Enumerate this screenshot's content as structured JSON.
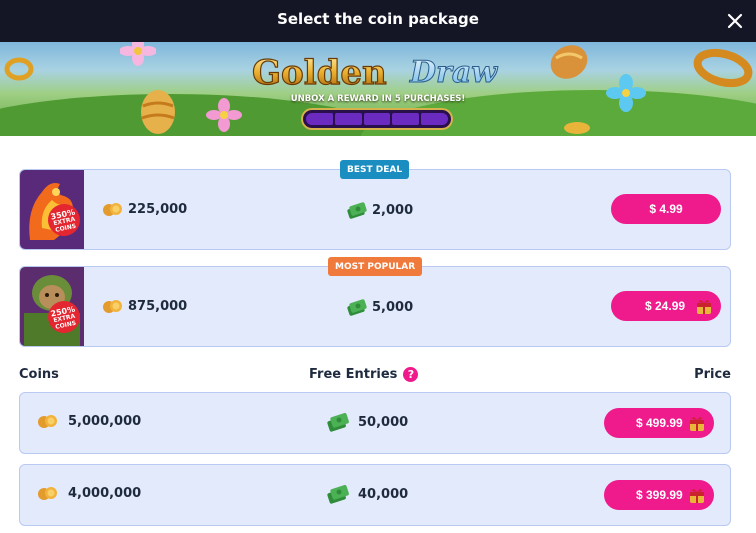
{
  "header": {
    "title": "Select the coin package",
    "close_icon": "close-icon"
  },
  "banner": {
    "logo_word1": "Golden",
    "logo_word2": "Draw",
    "tagline": "UNBOX A REWARD IN 5 PURCHASES!",
    "progress_segments": 5,
    "progress_filled": 0
  },
  "featured": [
    {
      "tag": "BEST DEAL",
      "tag_color": "#1a8ec0",
      "bonus_percent": "350%",
      "bonus_text": "EXTRA COINS",
      "coins": "225,000",
      "entries": "2,000",
      "price": "$ 4.99",
      "gift": false
    },
    {
      "tag": "MOST POPULAR",
      "tag_color": "#f07a3c",
      "bonus_percent": "250%",
      "bonus_text": "EXTRA COINS",
      "coins": "875,000",
      "entries": "5,000",
      "price": "$ 24.99",
      "gift": true
    }
  ],
  "table": {
    "headers": {
      "coins": "Coins",
      "entries": "Free Entries",
      "help": "?",
      "price": "Price"
    },
    "rows": [
      {
        "coins": "5,000,000",
        "entries": "50,000",
        "price": "$ 499.99",
        "gift": true
      },
      {
        "coins": "4,000,000",
        "entries": "40,000",
        "price": "$ 399.99",
        "gift": true
      }
    ]
  },
  "colors": {
    "accent": "#ef1b8d",
    "card_bg": "#e3eafc",
    "topbar": "#151625"
  }
}
